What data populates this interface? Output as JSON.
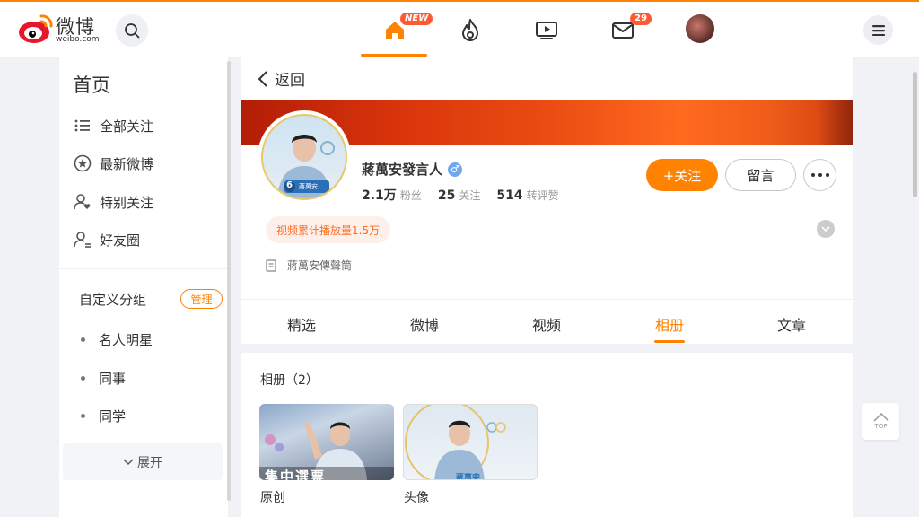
{
  "header": {
    "logo_text": "微博",
    "logo_sub": "weibo.com",
    "home_badge": "NEW",
    "message_count": "29"
  },
  "sidebar": {
    "title": "首页",
    "items": [
      {
        "label": "全部关注",
        "icon": "list-icon"
      },
      {
        "label": "最新微博",
        "icon": "star-circle-icon"
      },
      {
        "label": "特别关注",
        "icon": "user-heart-icon"
      },
      {
        "label": "好友圈",
        "icon": "user-group-icon"
      }
    ],
    "group_title": "自定义分组",
    "manage_label": "管理",
    "groups": [
      "名人明星",
      "同事",
      "同学"
    ],
    "expand_label": "展开"
  },
  "profile": {
    "back_label": "返回",
    "name": "蔣萬安發言人",
    "gender_icon": "male-icon",
    "followers_num": "2.1万",
    "followers_label": "粉丝",
    "following_num": "25",
    "following_label": "关注",
    "likes_num": "514",
    "likes_label": "转评赞",
    "follow_label": "+关注",
    "message_label": "留言",
    "video_stat": "视频累计播放量1.5万",
    "description": "蔣萬安傳聲筒",
    "avatar_number": "6",
    "avatar_name": "蔣萬安",
    "tabs": [
      "精选",
      "微博",
      "视频",
      "相册",
      "文章"
    ],
    "active_tab": "相册"
  },
  "album": {
    "title": "相册（2）",
    "items": [
      {
        "label": "原创",
        "overlay_text": "集中選票"
      },
      {
        "label": "头像",
        "overlay_text": "蔣萬安"
      }
    ]
  },
  "back_to_top": "TOP",
  "colors": {
    "accent": "#ff8200",
    "badge": "#ff5a36",
    "male": "#6ea8ee"
  }
}
